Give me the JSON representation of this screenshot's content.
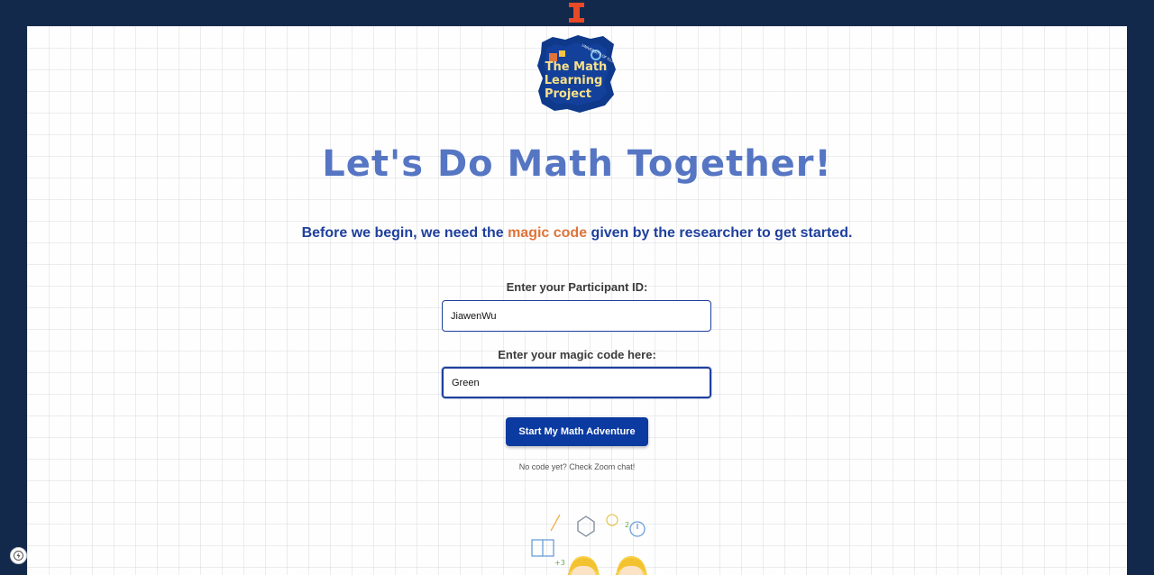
{
  "header": {
    "logo_icon": "university-block-i-logo",
    "brand_color": "#13294b",
    "accent_color": "#e84a27"
  },
  "project_logo": {
    "line1": "The Math",
    "line2": "Learning",
    "line3": "Project",
    "arc_text": "UNIVERSITY OF ILLINOIS"
  },
  "main": {
    "headline": "Let's Do Math Together!",
    "intro": {
      "before": "Before we begin, we need the ",
      "highlight": "magic code",
      "after": " given by the researcher to get started."
    },
    "participant_label": "Enter your Participant ID:",
    "participant_value": "JiawenWu",
    "code_label": "Enter your magic code here:",
    "code_value": "Green",
    "start_button": "Start My Math Adventure",
    "hint": "No code yet? Check Zoom chat!",
    "illustration_icon": "kids-math-doodle"
  },
  "badge_icon": "lightning-icon",
  "colors": {
    "headline": "#5676c4",
    "intro": "#1e3f9c",
    "highlight": "#e0743a",
    "button": "#0b3aa0"
  }
}
